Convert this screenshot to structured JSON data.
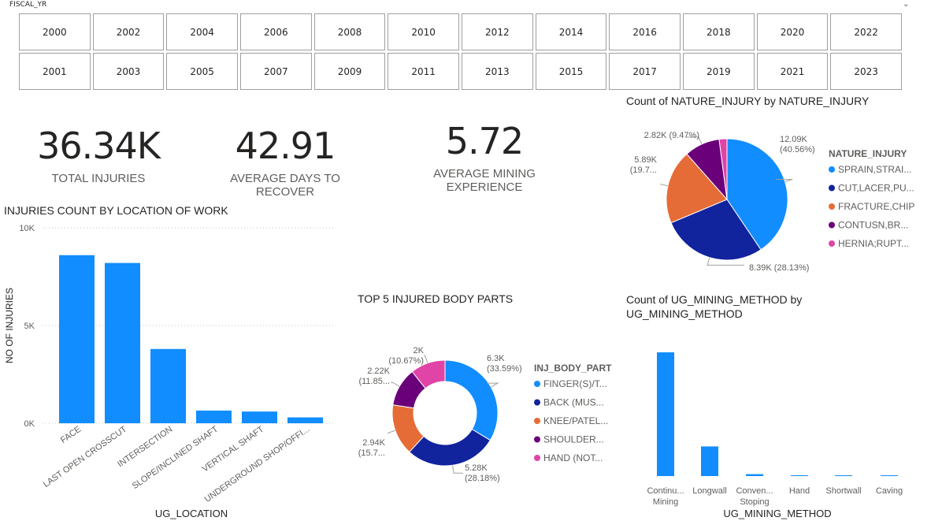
{
  "slicer": {
    "title": "FISCAL_YR",
    "years": [
      "2000",
      "2002",
      "2004",
      "2006",
      "2008",
      "2010",
      "2012",
      "2014",
      "2016",
      "2018",
      "2020",
      "2022",
      "2001",
      "2003",
      "2005",
      "2007",
      "2009",
      "2011",
      "2013",
      "2015",
      "2017",
      "2019",
      "2021",
      "2023"
    ]
  },
  "cards": [
    {
      "value": "36.34K",
      "label": "TOTAL INJURIES"
    },
    {
      "value": "42.91",
      "label": "AVERAGE DAYS TO RECOVER"
    },
    {
      "value": "5.72",
      "label": "AVERAGE MINING EXPERIENCE"
    }
  ],
  "colors": {
    "blue": "#118DFF",
    "navy": "#12239E",
    "orange": "#E66C37",
    "purple": "#6B007B",
    "pink": "#E044A7",
    "axis_text": "#605e5c",
    "gridline": "#c8c6c4"
  },
  "chart_data": [
    {
      "type": "bar",
      "title": "INJURIES COUNT BY LOCATION OF WORK",
      "xlabel": "UG_LOCATION",
      "ylabel": "NO OF INJURIES",
      "categories": [
        "FACE",
        "LAST OPEN CROSSCUT",
        "INTERSECTION",
        "SLOPE/INCLINED SHAFT",
        "VERTICAL SHAFT",
        "UNDERGROUND SHOP/OFFI..."
      ],
      "values": [
        8600,
        8200,
        3800,
        650,
        600,
        300
      ],
      "ylim": [
        0,
        10000
      ],
      "yticks": [
        "0K",
        "5K",
        "10K"
      ],
      "grid": true
    },
    {
      "type": "pie",
      "title": "Count of NATURE_INJURY by NATURE_INJURY",
      "legend_title": "NATURE_INJURY",
      "legend_position": "right",
      "slices": [
        {
          "label": "SPRAIN,STRAI...",
          "value": 12090,
          "value_text": "12.09K",
          "pct_text": "(40.56%)",
          "color": "#118DFF"
        },
        {
          "label": "CUT,LACER,PU...",
          "value": 8390,
          "value_text": "8.39K",
          "pct_text": "(28.13%)",
          "color": "#12239E"
        },
        {
          "label": "FRACTURE,CHIP",
          "value": 5890,
          "value_text": "5.89K",
          "pct_text": "(19.7...",
          "color": "#E66C37"
        },
        {
          "label": "CONTUSN,BR...",
          "value": 2820,
          "value_text": "2.82K",
          "pct_text": "(9.47%)",
          "color": "#6B007B"
        },
        {
          "label": "HERNIA;RUPT...",
          "value": 620,
          "value_text": "",
          "pct_text": "",
          "color": "#E044A7"
        }
      ]
    },
    {
      "type": "pie",
      "title": "TOP 5 INJURED BODY PARTS",
      "legend_title": "INJ_BODY_PART",
      "legend_position": "right",
      "donut": true,
      "slices": [
        {
          "label": "FINGER(S)/T...",
          "value": 6300,
          "value_text": "6.3K",
          "pct_text": "(33.59%)",
          "color": "#118DFF"
        },
        {
          "label": "BACK (MUS...",
          "value": 5280,
          "value_text": "5.28K",
          "pct_text": "(28.18%)",
          "color": "#12239E"
        },
        {
          "label": "KNEE/PATEL...",
          "value": 2940,
          "value_text": "2.94K",
          "pct_text": "(15.7...",
          "color": "#E66C37"
        },
        {
          "label": "SHOULDER...",
          "value": 2220,
          "value_text": "2.22K",
          "pct_text": "(11.85...",
          "color": "#6B007B"
        },
        {
          "label": "HAND (NOT...",
          "value": 2000,
          "value_text": "2K",
          "pct_text": "(10.67%)",
          "color": "#E044A7"
        }
      ]
    },
    {
      "type": "bar",
      "title": "Count of UG_MINING_METHOD by UG_MINING_METHOD",
      "xlabel": "UG_MINING_METHOD",
      "categories": [
        "Continu... Mining",
        "Longwall",
        "Conven... Stoping",
        "Hand",
        "Shortwall",
        "Caving"
      ],
      "category_lines": [
        [
          "Continu...",
          "Mining"
        ],
        [
          "Longwall"
        ],
        [
          "Conven...",
          "Stoping"
        ],
        [
          "Hand"
        ],
        [
          "Shortwall"
        ],
        [
          "Caving"
        ]
      ],
      "values": [
        9600,
        2300,
        150,
        60,
        30,
        10
      ],
      "ylim": [
        0,
        10000
      ],
      "grid": false
    }
  ]
}
